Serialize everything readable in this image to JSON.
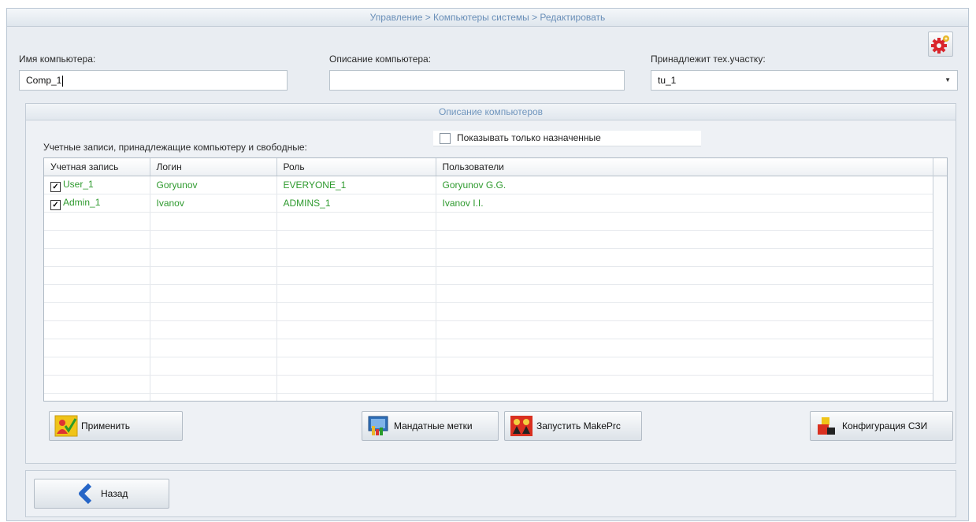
{
  "breadcrumb": "Управление > Компьютеры системы > Редактировать",
  "form": {
    "name_label": "Имя компьютера:",
    "name_value": "Comp_1",
    "desc_label": "Описание компьютера:",
    "desc_value": "",
    "site_label": "Принадлежит тех.участку:",
    "site_value": "tu_1"
  },
  "panel": {
    "title": "Описание компьютеров",
    "accounts_label": "Учетные записи, принадлежащие компьютеру и свободные:",
    "show_assigned_label": "Показывать только назначенные"
  },
  "table": {
    "columns": [
      "Учетная запись",
      "Логин",
      "Роль",
      "Пользователи"
    ],
    "rows": [
      {
        "account": "User_1",
        "login": "Goryunov",
        "role": "EVERYONE_1",
        "users": "Goryunov G.G.",
        "checked": true
      },
      {
        "account": "Admin_1",
        "login": "Ivanov",
        "role": "ADMINS_1",
        "users": "Ivanov I.I.",
        "checked": true
      }
    ]
  },
  "buttons": {
    "apply": "Применить",
    "mandatory_labels": "Мандатные метки",
    "run_makeprc": "Запустить MakePrc",
    "szi_config": "Конфигурация СЗИ",
    "back": "Назад"
  },
  "colors": {
    "row_text": "#2e9a2e",
    "breadcrumb": "#6a8fb8",
    "background": "#e9edf2"
  }
}
